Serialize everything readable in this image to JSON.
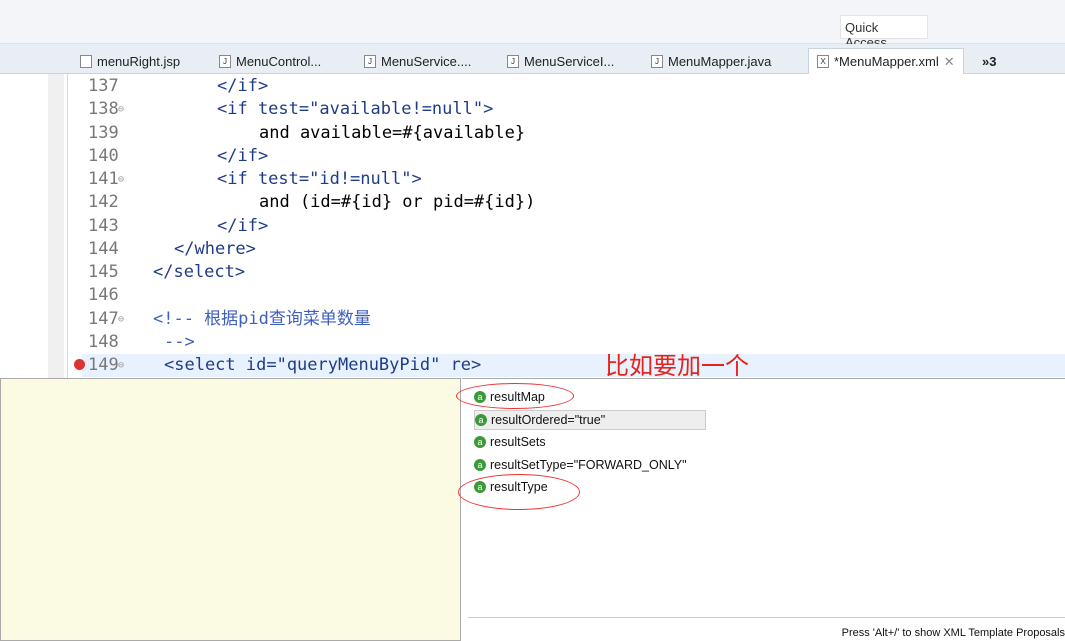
{
  "toolbar": {
    "quick_access": "Quick Access"
  },
  "tabs": [
    {
      "label": "menuRight.jsp",
      "icon": "jsp-file-icon"
    },
    {
      "label": "MenuControl...",
      "icon": "java-file-icon"
    },
    {
      "label": "MenuService....",
      "icon": "java-file-icon"
    },
    {
      "label": "MenuServiceI...",
      "icon": "java-file-icon"
    },
    {
      "label": "MenuMapper.java",
      "icon": "java-file-icon"
    },
    {
      "label": "*MenuMapper.xml",
      "icon": "xml-file-icon",
      "active": true
    }
  ],
  "tab_overflow": "»3",
  "editor": {
    "lines": [
      {
        "n": "137",
        "code": "</if>"
      },
      {
        "n": "138",
        "code": "<if test=\"available!=null\">"
      },
      {
        "n": "139",
        "code": "and available=#{available}"
      },
      {
        "n": "140",
        "code": "</if>"
      },
      {
        "n": "141",
        "code": "<if test=\"id!=null\">"
      },
      {
        "n": "142",
        "code": "and (id=#{id} or pid=#{id})"
      },
      {
        "n": "143",
        "code": "</if>"
      },
      {
        "n": "144",
        "code": "</where>"
      },
      {
        "n": "145",
        "code": "</select>"
      },
      {
        "n": "146",
        "code": ""
      },
      {
        "n": "147",
        "code": "<!-- 根据pid查询菜单数量"
      },
      {
        "n": "148",
        "code": "-->"
      },
      {
        "n": "149",
        "code": "<select id=\"queryMenuByPid\" re>"
      }
    ]
  },
  "annotation": "比如要加一个",
  "proposals": [
    "resultMap",
    "resultOrdered=\"true\"",
    "resultSets",
    "resultSetType=\"FORWARD_ONLY\"",
    "resultType"
  ],
  "status": "Press 'Alt+/' to show XML Template Proposals",
  "colors": {
    "annotation": "#e8221b",
    "info_bg": "#fbfbe3"
  }
}
